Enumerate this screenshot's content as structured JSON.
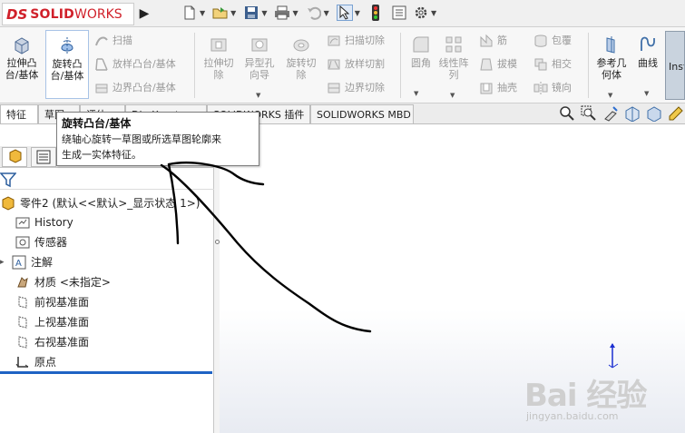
{
  "app": {
    "logo_prefix": "DS",
    "logo_solid": "SOLID",
    "logo_works": "WORKS"
  },
  "quick_access": {
    "icons": [
      "new-document-icon",
      "open-folder-icon",
      "save-icon",
      "print-icon",
      "undo-icon",
      "select-pointer-icon",
      "traffic-light-icon",
      "file-properties-icon",
      "options-gear-icon"
    ]
  },
  "ribbon": {
    "extrude_boss": "拉伸凸\n台/基体",
    "revolve_boss": "旋转凸\n台/基体",
    "sweep": "扫描",
    "loft": "放样凸台/基体",
    "boundary": "边界凸台/基体",
    "extrude_cut": "拉伸切\n除",
    "hole_wizard": "异型孔\n向导",
    "revolve_cut": "旋转切\n除",
    "swept_cut": "扫描切除",
    "lofted_cut": "放样切割",
    "boundary_cut": "边界切除",
    "fillet": "圆角",
    "linear_pattern": "线性阵\n列",
    "rib": "筋",
    "draft": "拔模",
    "shell": "抽壳",
    "wrap": "包覆",
    "intersect": "相交",
    "mirror": "镜向",
    "reference_geometry": "参考几\n何体",
    "curves": "曲线",
    "instant3d": "Inst"
  },
  "tabs": [
    "特征",
    "草图",
    "评估",
    "DimXpert",
    "SOLIDWORKS 插件",
    "SOLIDWORKS MBD"
  ],
  "tooltip": {
    "title": "旋转凸台/基体",
    "line1": "绕轴心旋转一草图或所选草图轮廓来",
    "line2": "生成一实体特征。"
  },
  "tree": {
    "root": "零件2 (默认<<默认>_显示状态 1>)",
    "items": [
      "History",
      "传感器",
      "注解",
      "材质 <未指定>",
      "前视基准面",
      "上视基准面",
      "右视基准面",
      "原点"
    ]
  },
  "colors": {
    "brand_red": "#d0202a",
    "accent_blue": "#1e63c4",
    "scribble": "#000000"
  },
  "watermark": {
    "main": "Bai 经验",
    "sub": "jingyan.baidu.com"
  }
}
